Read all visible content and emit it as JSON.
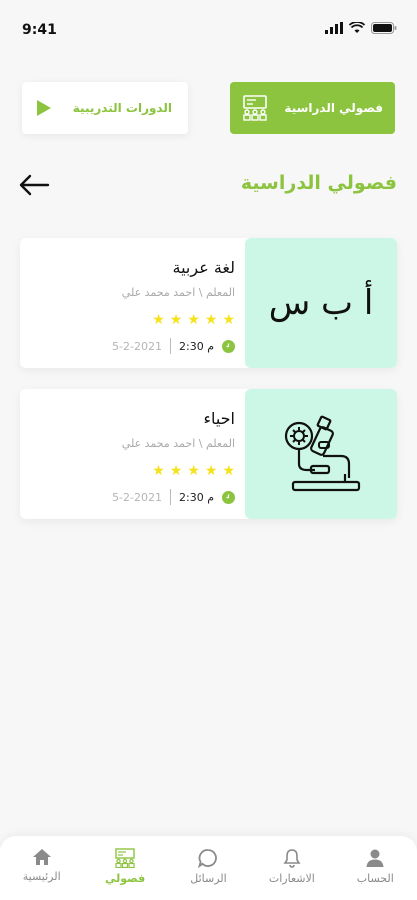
{
  "status": {
    "time": "9:41"
  },
  "tabs": {
    "training": {
      "label": "الدورات التدريبية",
      "icon": "play-icon"
    },
    "classes": {
      "label": "فصولي الدراسية",
      "icon": "classroom-icon"
    }
  },
  "section": {
    "title": "فصولي الدراسية",
    "back_icon": "arrow-left-icon"
  },
  "courses": [
    {
      "name": "لغة عربية",
      "teacher": "المعلم \\ احمد محمد علي",
      "rating": 5,
      "time": "2:30 م",
      "date": "5-2-2021",
      "image_text": "أ ب س"
    },
    {
      "name": "احياء",
      "teacher": "المعلم \\ احمد محمد علي",
      "rating": 5,
      "time": "2:30 م",
      "date": "5-2-2021",
      "image_icon": "microscope-icon"
    }
  ],
  "nav": [
    {
      "label": "الرئيسية",
      "icon": "home-icon"
    },
    {
      "label": "فصولي",
      "icon": "classroom-icon",
      "active": true
    },
    {
      "label": "الرسائل",
      "icon": "chat-icon"
    },
    {
      "label": "الاشعارات",
      "icon": "bell-icon"
    },
    {
      "label": "الحساب",
      "icon": "user-icon"
    }
  ],
  "colors": {
    "accent": "#8cc43f",
    "card_image_bg": "#ccf7e6",
    "star": "#f5e21b"
  }
}
